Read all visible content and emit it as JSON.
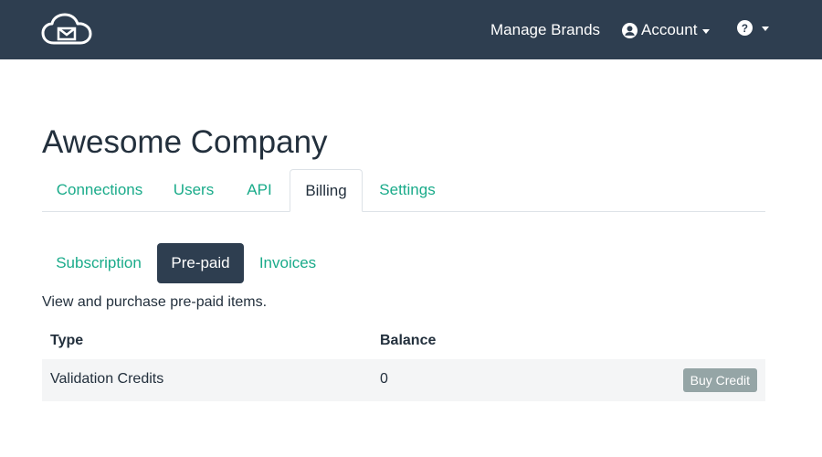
{
  "header": {
    "logo_icon": "cloud-mail-icon",
    "manage_brands": "Manage Brands",
    "account_label": "Account",
    "account_icon": "user-circle-icon",
    "help_icon": "question-circle-icon"
  },
  "page": {
    "title": "Awesome Company"
  },
  "main_tabs": [
    {
      "label": "Connections"
    },
    {
      "label": "Users"
    },
    {
      "label": "API"
    },
    {
      "label": "Billing",
      "active": true
    },
    {
      "label": "Settings"
    }
  ],
  "sub_tabs": [
    {
      "label": "Subscription"
    },
    {
      "label": "Pre-paid",
      "active": true
    },
    {
      "label": "Invoices"
    }
  ],
  "prepaid": {
    "description": "View and purchase pre-paid items.",
    "columns": [
      "Type",
      "Balance"
    ],
    "rows": [
      {
        "type": "Validation Credits",
        "balance": "0",
        "action": "Buy Credit"
      }
    ]
  },
  "colors": {
    "header_bg": "#2e3e50",
    "accent": "#1aab8a",
    "button_gray": "#95a5a6"
  }
}
